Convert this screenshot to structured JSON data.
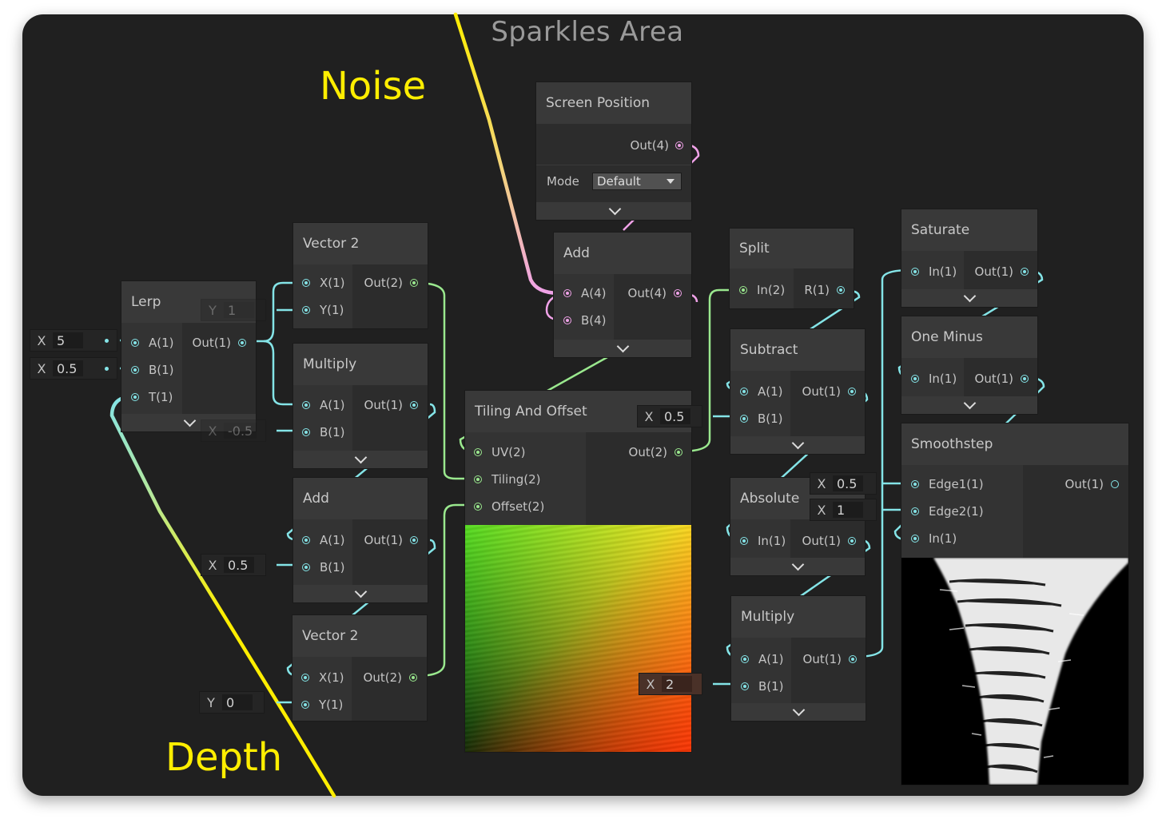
{
  "canvas": {
    "title": "Sparkles Area"
  },
  "annotations": {
    "noise": "Noise",
    "depth": "Depth"
  },
  "colors": {
    "background": "#202020",
    "annotation": "#ffee00",
    "port_float": "#84e4e7",
    "port_vector2": "#9ae88e",
    "port_vector4": "#f0a2e8"
  },
  "nodes": {
    "screen_position": {
      "title": "Screen Position",
      "out": "Out(4)",
      "mode_label": "Mode",
      "mode_value": "Default"
    },
    "add_top": {
      "title": "Add",
      "a": "A(4)",
      "b": "B(4)",
      "out": "Out(4)"
    },
    "lerp": {
      "title": "Lerp",
      "a": "A(1)",
      "b": "B(1)",
      "t": "T(1)",
      "out": "Out(1)"
    },
    "vector2_top": {
      "title": "Vector 2",
      "x": "X(1)",
      "y": "Y(1)",
      "out": "Out(2)"
    },
    "multiply_left": {
      "title": "Multiply",
      "a": "A(1)",
      "b": "B(1)",
      "out": "Out(1)"
    },
    "add_left": {
      "title": "Add",
      "a": "A(1)",
      "b": "B(1)",
      "out": "Out(1)"
    },
    "vector2_bottom": {
      "title": "Vector 2",
      "x": "X(1)",
      "y": "Y(1)",
      "out": "Out(2)"
    },
    "tiling_offset": {
      "title": "Tiling And Offset",
      "uv": "UV(2)",
      "tiling": "Tiling(2)",
      "offset": "Offset(2)",
      "out": "Out(2)"
    },
    "split": {
      "title": "Split",
      "in": "In(2)",
      "out": "R(1)"
    },
    "subtract": {
      "title": "Subtract",
      "a": "A(1)",
      "b": "B(1)",
      "out": "Out(1)"
    },
    "absolute": {
      "title": "Absolute",
      "in": "In(1)",
      "out": "Out(1)"
    },
    "multiply_right": {
      "title": "Multiply",
      "a": "A(1)",
      "b": "B(1)",
      "out": "Out(1)"
    },
    "saturate": {
      "title": "Saturate",
      "in": "In(1)",
      "out": "Out(1)"
    },
    "one_minus": {
      "title": "One Minus",
      "in": "In(1)",
      "out": "Out(1)"
    },
    "smoothstep": {
      "title": "Smoothstep",
      "edge1": "Edge1(1)",
      "edge2": "Edge2(1)",
      "in": "In(1)",
      "out": "Out(1)"
    }
  },
  "fields": {
    "lerp_a": {
      "label": "X",
      "value": "5"
    },
    "lerp_b": {
      "label": "X",
      "value": "0.5"
    },
    "vector2_top_y": {
      "label": "Y",
      "value": "1"
    },
    "multiply_left_b": {
      "label": "X",
      "value": "-0.5"
    },
    "add_left_b": {
      "label": "X",
      "value": "0.5"
    },
    "vector2_bottom_y": {
      "label": "Y",
      "value": "0"
    },
    "subtract_b": {
      "label": "X",
      "value": "0.5"
    },
    "multiply_right_b": {
      "label": "X",
      "value": "2"
    },
    "smoothstep_edge1": {
      "label": "X",
      "value": "0.5"
    },
    "smoothstep_edge2": {
      "label": "X",
      "value": "1"
    }
  }
}
